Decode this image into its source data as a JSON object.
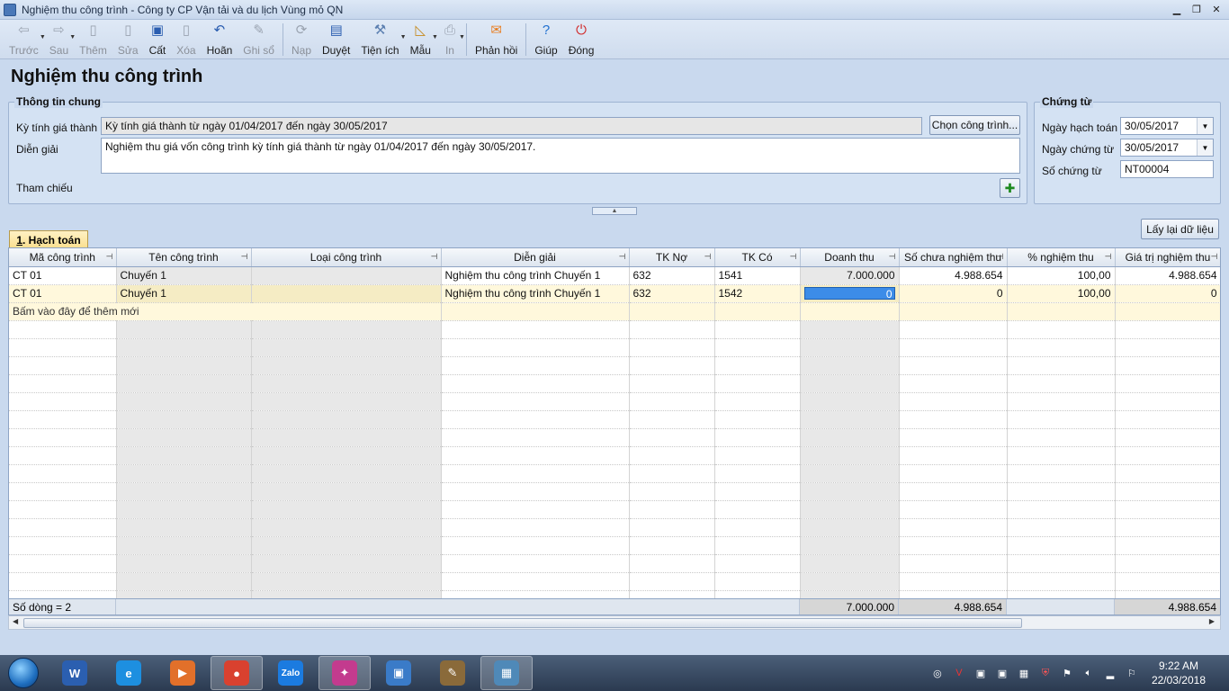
{
  "window": {
    "title": "Nghiệm thu công trình - Công ty CP Vận tải và du lịch Vùng mỏ QN"
  },
  "toolbar": {
    "items": [
      {
        "label": "Trước",
        "icon": "arrow-left-icon",
        "glyph": "⇦",
        "disabled": true,
        "dropdown": true
      },
      {
        "label": "Sau",
        "icon": "arrow-right-icon",
        "glyph": "⇨",
        "disabled": true,
        "dropdown": true
      },
      {
        "label": "Thêm",
        "icon": "add-document-icon",
        "glyph": "▯",
        "disabled": true
      },
      {
        "label": "Sửa",
        "icon": "edit-document-icon",
        "glyph": "▯",
        "disabled": true
      },
      {
        "label": "Cất",
        "icon": "save-icon",
        "glyph": "▣",
        "disabled": false
      },
      {
        "label": "Xóa",
        "icon": "delete-document-icon",
        "glyph": "▯",
        "disabled": true
      },
      {
        "label": "Hoãn",
        "icon": "undo-icon",
        "glyph": "↶",
        "disabled": false
      },
      {
        "label": "Ghi sổ",
        "icon": "pencil-icon",
        "glyph": "✎",
        "disabled": true
      },
      {
        "label": "Nạp",
        "icon": "reload-icon",
        "glyph": "⟳",
        "disabled": true
      },
      {
        "label": "Duyệt",
        "icon": "browse-icon",
        "glyph": "▤",
        "disabled": false
      },
      {
        "label": "Tiện ích",
        "icon": "tools-icon",
        "glyph": "⚒",
        "disabled": false,
        "dropdown": true
      },
      {
        "label": "Mẫu",
        "icon": "template-icon",
        "glyph": "◺",
        "disabled": false,
        "dropdown": true
      },
      {
        "label": "In",
        "icon": "print-icon",
        "glyph": "⎙",
        "disabled": true,
        "dropdown": true
      },
      {
        "label": "Phản hồi",
        "icon": "feedback-mail-icon",
        "glyph": "✉",
        "disabled": false
      },
      {
        "label": "Giúp",
        "icon": "help-icon",
        "glyph": "?",
        "disabled": false
      },
      {
        "label": "Đóng",
        "icon": "close-power-icon",
        "glyph": "⏻",
        "disabled": false
      }
    ]
  },
  "page": {
    "title": "Nghiệm thu công trình"
  },
  "general": {
    "title": "Thông tin chung",
    "period_label": "Kỳ tính giá thành",
    "period_value": "Kỳ tính giá thành từ ngày 01/04/2017 đến ngày 30/05/2017",
    "choose_button": "Chọn công trình...",
    "description_label": "Diễn giải",
    "description_value": "Nghiệm thu giá vốn công trình kỳ tính giá thành từ ngày 01/04/2017 đến ngày 30/05/2017.",
    "reference_label": "Tham chiếu"
  },
  "voucher": {
    "title": "Chứng từ",
    "posting_date_label": "Ngày hạch toán",
    "posting_date_value": "30/05/2017",
    "voucher_date_label": "Ngày chứng từ",
    "voucher_date_value": "30/05/2017",
    "voucher_no_label": "Số chứng từ",
    "voucher_no_value": "NT00004"
  },
  "reload_button": "Lấy lại dữ liệu",
  "tab": {
    "number": "1",
    "label": ". Hạch toán"
  },
  "grid": {
    "columns": [
      "Mã công trình",
      "Tên công trình",
      "Loại công trình",
      "Diễn giải",
      "TK Nợ",
      "TK Có",
      "Doanh thu",
      "Số chưa nghiệm thu",
      "% nghiệm thu",
      "Giá trị nghiệm thu"
    ],
    "rows": [
      [
        "CT 01",
        "Chuyến 1",
        "",
        "Nghiệm thu công trình Chuyến 1",
        "632",
        "1541",
        "7.000.000",
        "4.988.654",
        "100,00",
        "4.988.654"
      ],
      [
        "CT 01",
        "Chuyến 1",
        "",
        "Nghiệm thu công trình Chuyến 1",
        "632",
        "1542",
        "0",
        "0",
        "100,00",
        "0"
      ]
    ],
    "add_new_text": "Bấm vào đây để thêm mới",
    "footer": {
      "row_count": "Số dòng = 2",
      "revenue_total": "7.000.000",
      "unaccepted_total": "4.988.654",
      "accepted_total": "4.988.654"
    }
  },
  "taskbar": {
    "apps": [
      {
        "name": "word",
        "icon": "word-icon",
        "text": "W",
        "color": "#2b5fb0"
      },
      {
        "name": "ie",
        "icon": "internet-explorer-icon",
        "text": "e",
        "color": "#1d8fe0"
      },
      {
        "name": "media",
        "icon": "media-player-icon",
        "text": "▶",
        "color": "#e2702a"
      },
      {
        "name": "chrome",
        "icon": "chrome-icon",
        "text": "●",
        "color": "#d9412f"
      },
      {
        "name": "zalo",
        "icon": "zalo-icon",
        "text": "Zalo",
        "color": "#1b7be0"
      },
      {
        "name": "picasa",
        "icon": "picasa-icon",
        "text": "✦",
        "color": "#c33b8e"
      },
      {
        "name": "remote",
        "icon": "remote-desktop-icon",
        "text": "▣",
        "color": "#3a7bc8"
      },
      {
        "name": "paint",
        "icon": "paint-icon",
        "text": "✎",
        "color": "#8a6a3a"
      },
      {
        "name": "photos",
        "icon": "photo-viewer-icon",
        "text": "▦",
        "color": "#4f89b8"
      }
    ],
    "clock_time": "9:22 AM",
    "clock_date": "22/03/2018"
  }
}
